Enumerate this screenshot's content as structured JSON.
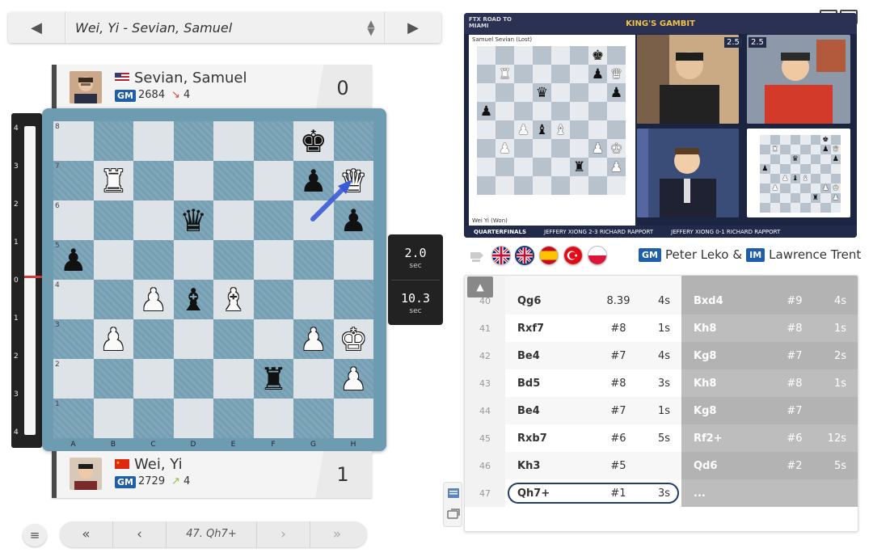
{
  "game_selector": {
    "title": "Wei, Yi - Sevian, Samuel",
    "prev_icon": "◀",
    "next_icon": "▶",
    "updown_icon": "▲▼"
  },
  "top_player": {
    "name": "Sevian, Samuel",
    "title": "GM",
    "rating": "2684",
    "change": "4",
    "change_dir": "down",
    "score": "0",
    "flag": "US"
  },
  "bottom_player": {
    "name": "Wei, Yi",
    "title": "GM",
    "rating": "2729",
    "change": "4",
    "change_dir": "up",
    "score": "1",
    "flag": "CN"
  },
  "eval_ticks": [
    "4",
    "3",
    "2",
    "1",
    "0",
    "1",
    "2",
    "3",
    "4"
  ],
  "board": {
    "ranks": [
      "8",
      "7",
      "6",
      "5",
      "4",
      "3",
      "2",
      "1"
    ],
    "files": [
      "A",
      "B",
      "C",
      "D",
      "E",
      "F",
      "G",
      "H"
    ],
    "position": [
      [
        "",
        "",
        "",
        "",
        "",
        "",
        "k",
        ""
      ],
      [
        "",
        "R",
        "",
        "",
        "",
        "",
        "p",
        "Q"
      ],
      [
        "",
        "",
        "",
        "q",
        "",
        "",
        "",
        "p"
      ],
      [
        "p",
        "",
        "",
        "",
        "",
        "",
        "",
        ""
      ],
      [
        "",
        "",
        "P",
        "b",
        "B",
        "",
        "",
        ""
      ],
      [
        "",
        "P",
        "",
        "",
        "",
        "",
        "P",
        "K"
      ],
      [
        "",
        "",
        "",
        "",
        "",
        "r",
        "",
        "P"
      ],
      [
        "",
        "",
        "",
        "",
        "",
        "",
        "",
        ""
      ]
    ],
    "last_move": {
      "from": "g6",
      "to": "h7"
    }
  },
  "timers": {
    "top": "2.0",
    "top_unit": "sec",
    "bottom": "10.3",
    "bottom_unit": "sec"
  },
  "nav": {
    "first": "«",
    "prev": "‹",
    "move_label": "47. Qh7+",
    "next": "›",
    "last": "»"
  },
  "menu_icon": "≡",
  "video": {
    "event": "FTX ROAD TO MIAMI",
    "banner": "KING'S GAMBIT",
    "stage": "QUARTERFINALS",
    "board_top_player": "Samuel Sevian (Lost)",
    "board_bottom_player": "Wei Yi (Won)",
    "score_left": "2.5",
    "score_right": "2.5",
    "match1": "JEFFERY XIONG 2-3 RICHARD RAPPORT",
    "match2": "JEFFERY XIONG 0-1 RICHARD RAPPORT"
  },
  "commentators": {
    "c1_title": "GM",
    "c1_name": "Peter Leko",
    "amp": "&",
    "c2_title": "IM",
    "c2_name": "Lawrence Trent"
  },
  "moves": [
    {
      "no": "40",
      "w": "Qg6",
      "w_eval": "8.39",
      "w_time": "4s",
      "b": "Bxd4",
      "b_eval": "#9",
      "b_time": "4s"
    },
    {
      "no": "41",
      "w": "Rxf7",
      "w_eval": "#8",
      "w_time": "1s",
      "b": "Kh8",
      "b_eval": "#8",
      "b_time": "1s"
    },
    {
      "no": "42",
      "w": "Be4",
      "w_eval": "#7",
      "w_time": "4s",
      "b": "Kg8",
      "b_eval": "#7",
      "b_time": "2s"
    },
    {
      "no": "43",
      "w": "Bd5",
      "w_eval": "#8",
      "w_time": "3s",
      "b": "Kh8",
      "b_eval": "#8",
      "b_time": "1s"
    },
    {
      "no": "44",
      "w": "Be4",
      "w_eval": "#7",
      "w_time": "1s",
      "b": "Kg8",
      "b_eval": "#7",
      "b_time": ""
    },
    {
      "no": "45",
      "w": "Rxb7",
      "w_eval": "#6",
      "w_time": "5s",
      "b": "Rf2+",
      "b_eval": "#6",
      "b_time": "12s"
    },
    {
      "no": "46",
      "w": "Kh3",
      "w_eval": "#5",
      "w_time": "",
      "b": "Qd6",
      "b_eval": "#2",
      "b_time": "5s"
    },
    {
      "no": "47",
      "w": "Qh7+",
      "w_eval": "#1",
      "w_time": "3s",
      "b": "...",
      "b_eval": "",
      "b_time": ""
    }
  ],
  "colors": {
    "accent_blue": "#1f5ea8",
    "board_dark": "#7aa3b7",
    "board_light": "#dde3e7",
    "arrow": "#3b5bd6"
  }
}
